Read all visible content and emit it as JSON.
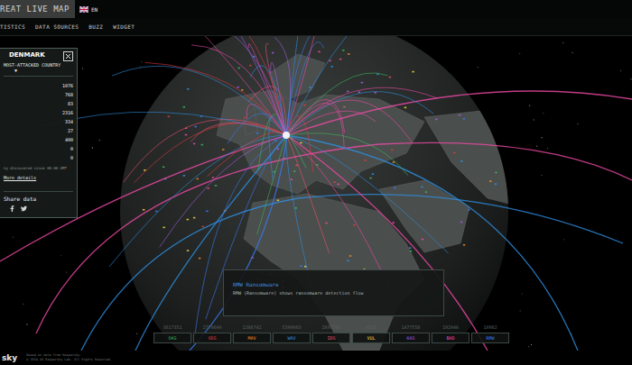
{
  "header": {
    "title": "REAT LIVE MAP",
    "language": "EN"
  },
  "nav": [
    {
      "label": "TISTICS"
    },
    {
      "label": "DATA SOURCES"
    },
    {
      "label": "BUZZ"
    },
    {
      "label": "WIDGET"
    }
  ],
  "country_panel": {
    "country": "DENMARK",
    "rank_label": "MOST-ATTACKED COUNTRY",
    "dropdown": "▼",
    "stats": [
      "1076",
      "768",
      "83",
      "2316",
      "334",
      "27",
      "400",
      "0",
      "0"
    ],
    "note": "ny discovered since 00:00 GMT",
    "link": "More details",
    "share_label": "Share data"
  },
  "notice": {
    "title": "RMW Ransomware",
    "text": "RMW (Ransomware) shows ransomware detection flow"
  },
  "legend": [
    {
      "code": "OAS",
      "count": "3617351",
      "color": "#3fb35f"
    },
    {
      "code": "ODS",
      "count": "2770600",
      "color": "#e0393e"
    },
    {
      "code": "MAV",
      "count": "1386742",
      "color": "#f08a24"
    },
    {
      "code": "WAV",
      "count": "5309083",
      "color": "#2f8fe0"
    },
    {
      "code": "IDS",
      "count": "2697785",
      "color": "#f0506e"
    },
    {
      "code": "VUL",
      "count": "9825",
      "color": "#f2d43c"
    },
    {
      "code": "KAS",
      "count": "1477556",
      "color": "#a45de0"
    },
    {
      "code": "BAD",
      "count": "192046",
      "color": "#f04aa8"
    },
    {
      "code": "RMW",
      "count": "10962",
      "color": "#3a7bf0"
    }
  ],
  "footer": {
    "logo": "sky",
    "lines": [
      "Based on data from Kaspersky.",
      "© 2024 AO Kaspersky Lab. All Rights Reserved."
    ]
  }
}
